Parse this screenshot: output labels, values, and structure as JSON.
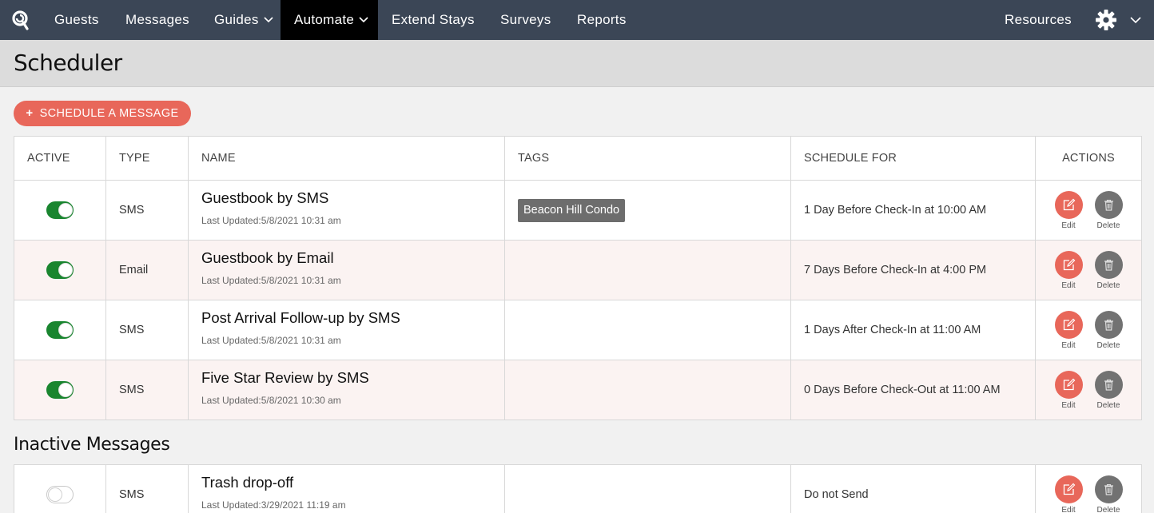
{
  "nav": {
    "items": [
      {
        "label": "Guests"
      },
      {
        "label": "Messages"
      },
      {
        "label": "Guides"
      },
      {
        "label": "Automate"
      },
      {
        "label": "Extend Stays"
      },
      {
        "label": "Surveys"
      },
      {
        "label": "Reports"
      }
    ],
    "resources": "Resources",
    "active_item": "Automate"
  },
  "page": {
    "title": "Scheduler",
    "schedule_button": "SCHEDULE A MESSAGE",
    "inactive_title": "Inactive Messages"
  },
  "table": {
    "headers": {
      "active": "ACTIVE",
      "type": "TYPE",
      "name": "NAME",
      "tags": "TAGS",
      "schedule": "SCHEDULE FOR",
      "actions": "ACTIONS"
    },
    "edit_label": "Edit",
    "delete_label": "Delete",
    "active_rows": [
      {
        "active": true,
        "type": "SMS",
        "name": "Guestbook by SMS",
        "updated": "Last Updated:5/8/2021 10:31 am",
        "tag": "Beacon Hill Condo",
        "schedule": "1 Day Before Check-In at 10:00 AM"
      },
      {
        "active": true,
        "type": "Email",
        "name": "Guestbook by Email",
        "updated": "Last Updated:5/8/2021 10:31 am",
        "tag": "",
        "schedule": "7 Days Before Check-In at 4:00 PM"
      },
      {
        "active": true,
        "type": "SMS",
        "name": "Post Arrival Follow-up by SMS",
        "updated": "Last Updated:5/8/2021 10:31 am",
        "tag": "",
        "schedule": "1 Days After Check-In at 11:00 AM"
      },
      {
        "active": true,
        "type": "SMS",
        "name": "Five Star Review by SMS",
        "updated": "Last Updated:5/8/2021 10:30 am",
        "tag": "",
        "schedule": "0 Days Before Check-Out at 11:00 AM"
      }
    ],
    "inactive_rows": [
      {
        "active": false,
        "type": "SMS",
        "name": "Trash drop-off",
        "updated": "Last Updated:3/29/2021 11:19 am",
        "tag": "",
        "schedule": "Do not Send"
      }
    ]
  },
  "colors": {
    "nav_bg": "#3b4656",
    "accent": "#e8675a",
    "toggle_on": "#19852f",
    "delete_gray": "#727272"
  }
}
